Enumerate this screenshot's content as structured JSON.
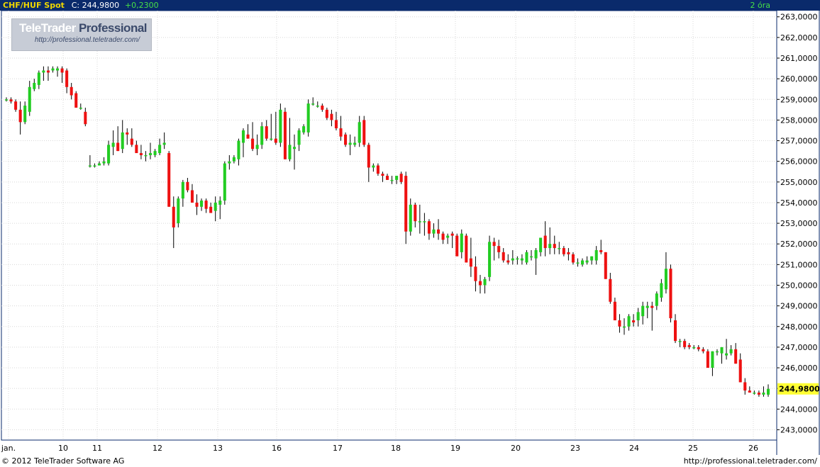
{
  "header": {
    "symbol": "CHF/HUF Spot",
    "close_label": "C: 244,9800",
    "change": "+0,2300",
    "interval": "2 óra"
  },
  "logo": {
    "brand": "TeleTrader",
    "brand_suffix": "Professional",
    "url": "http://professional.teletrader.com/"
  },
  "footer": {
    "copyright": "© 2012  TeleTrader Software AG",
    "url": "http://professional.teletrader.com/"
  },
  "colors": {
    "up": "#22cc22",
    "down": "#ee1111",
    "wick": "#000000",
    "grid": "#d8d8d8",
    "axis_bg": "#ffffff",
    "frame": "#0a2a6b",
    "last_price_bg": "#ffff33"
  },
  "chart_data": {
    "type": "candlestick",
    "ylim": [
      242.5,
      263.3
    ],
    "yticks": [
      "263,0000",
      "262,0000",
      "261,0000",
      "260,0000",
      "259,0000",
      "258,0000",
      "257,0000",
      "256,0000",
      "255,0000",
      "254,0000",
      "253,0000",
      "252,0000",
      "251,0000",
      "250,0000",
      "249,0000",
      "248,0000",
      "247,0000",
      "246,0000",
      "245,0000",
      "244,0000",
      "243,0000"
    ],
    "ytick_values": [
      263,
      262,
      261,
      260,
      259,
      258,
      257,
      256,
      255,
      254,
      253,
      252,
      251,
      250,
      249,
      248,
      247,
      246,
      244,
      243
    ],
    "last_price": 244.98,
    "last_price_label": "244,9800",
    "xticks": [
      "jan.",
      "10",
      "11",
      "12",
      "13",
      "16",
      "17",
      "18",
      "19",
      "20",
      "23",
      "24",
      "25",
      "26"
    ],
    "candles": [
      [
        259.0,
        259.1,
        258.9,
        259.0
      ],
      [
        259.0,
        259.1,
        258.8,
        258.9
      ],
      [
        258.9,
        259.0,
        258.4,
        258.5
      ],
      [
        258.5,
        258.9,
        257.3,
        257.9
      ],
      [
        257.9,
        258.9,
        257.8,
        258.7
      ],
      [
        258.4,
        259.9,
        258.2,
        259.6
      ],
      [
        259.5,
        260.0,
        259.4,
        259.8
      ],
      [
        259.7,
        260.4,
        259.5,
        260.3
      ],
      [
        260.3,
        260.6,
        259.9,
        260.4
      ],
      [
        260.4,
        260.6,
        259.9,
        260.3
      ],
      [
        260.4,
        260.6,
        260.3,
        260.5
      ],
      [
        260.4,
        260.6,
        260.1,
        260.5
      ],
      [
        260.5,
        260.6,
        259.8,
        260.3
      ],
      [
        260.4,
        260.5,
        259.3,
        259.6
      ],
      [
        259.6,
        259.8,
        259.0,
        259.2
      ],
      [
        259.3,
        259.4,
        258.6,
        258.6
      ],
      [
        258.6,
        258.8,
        258.5,
        258.6
      ],
      [
        258.4,
        258.6,
        257.7,
        257.8
      ],
      [
        255.8,
        256.3,
        255.7,
        255.8
      ],
      [
        255.8,
        255.9,
        255.7,
        255.8
      ],
      [
        255.8,
        256.0,
        255.8,
        255.9
      ],
      [
        255.9,
        256.2,
        255.8,
        256.0
      ],
      [
        255.9,
        257.0,
        255.8,
        256.8
      ],
      [
        256.7,
        257.5,
        256.3,
        256.9
      ],
      [
        256.9,
        257.7,
        256.5,
        256.5
      ],
      [
        256.6,
        258.0,
        256.4,
        257.4
      ],
      [
        257.4,
        257.6,
        256.8,
        257.3
      ],
      [
        257.1,
        257.6,
        256.7,
        256.8
      ],
      [
        256.8,
        257.0,
        256.5,
        256.4
      ],
      [
        256.4,
        256.8,
        256.1,
        256.3
      ],
      [
        256.3,
        256.5,
        256.0,
        256.3
      ],
      [
        256.3,
        256.9,
        256.1,
        256.4
      ],
      [
        256.3,
        256.6,
        256.2,
        256.5
      ],
      [
        256.4,
        257.1,
        256.3,
        256.8
      ],
      [
        256.8,
        257.4,
        256.6,
        256.9
      ],
      [
        256.4,
        256.5,
        253.8,
        253.8
      ],
      [
        253.8,
        254.3,
        251.8,
        252.8
      ],
      [
        253.0,
        254.3,
        252.8,
        254.2
      ],
      [
        254.2,
        255.1,
        253.8,
        255.0
      ],
      [
        255.0,
        255.2,
        254.5,
        254.6
      ],
      [
        254.6,
        254.9,
        254.0,
        254.0
      ],
      [
        254.0,
        254.4,
        253.4,
        253.8
      ],
      [
        253.8,
        254.2,
        253.6,
        254.1
      ],
      [
        254.1,
        254.2,
        253.5,
        253.7
      ],
      [
        253.8,
        254.0,
        253.5,
        253.5
      ],
      [
        253.6,
        254.3,
        253.1,
        254.0
      ],
      [
        253.9,
        254.3,
        253.2,
        254.1
      ],
      [
        254.1,
        256.0,
        253.9,
        255.9
      ],
      [
        255.9,
        256.3,
        255.6,
        256.0
      ],
      [
        256.0,
        256.3,
        255.9,
        256.2
      ],
      [
        256.1,
        257.1,
        255.8,
        257.0
      ],
      [
        256.9,
        257.6,
        256.2,
        257.5
      ],
      [
        257.3,
        257.8,
        257.1,
        257.1
      ],
      [
        257.1,
        257.9,
        256.5,
        256.6
      ],
      [
        256.6,
        257.3,
        256.3,
        256.8
      ],
      [
        256.8,
        257.9,
        256.6,
        257.7
      ],
      [
        257.7,
        258.0,
        257.0,
        257.1
      ],
      [
        257.1,
        258.3,
        257.0,
        257.1
      ],
      [
        257.1,
        258.4,
        256.8,
        256.9
      ],
      [
        256.9,
        258.8,
        256.7,
        258.5
      ],
      [
        258.4,
        258.6,
        256.1,
        256.1
      ],
      [
        256.1,
        258.1,
        256.0,
        256.8
      ],
      [
        256.6,
        257.3,
        255.6,
        256.7
      ],
      [
        256.8,
        257.6,
        256.5,
        257.5
      ],
      [
        257.4,
        257.8,
        257.3,
        257.7
      ],
      [
        257.4,
        259.0,
        257.2,
        258.8
      ],
      [
        258.8,
        259.1,
        258.7,
        258.8
      ],
      [
        258.7,
        258.9,
        258.6,
        258.7
      ],
      [
        258.7,
        258.8,
        258.4,
        258.5
      ],
      [
        258.5,
        258.6,
        258.0,
        258.1
      ],
      [
        258.3,
        258.5,
        257.7,
        258.0
      ],
      [
        258.0,
        258.4,
        257.5,
        257.6
      ],
      [
        257.6,
        258.2,
        257.0,
        257.2
      ],
      [
        257.3,
        257.4,
        256.7,
        256.8
      ],
      [
        256.8,
        257.3,
        256.3,
        256.9
      ],
      [
        256.8,
        257.2,
        256.7,
        256.9
      ],
      [
        256.9,
        258.2,
        256.7,
        257.9
      ],
      [
        258.0,
        258.2,
        256.7,
        256.8
      ],
      [
        256.8,
        256.9,
        255.0,
        255.7
      ],
      [
        255.7,
        255.9,
        255.5,
        255.8
      ],
      [
        255.8,
        255.9,
        255.3,
        255.4
      ],
      [
        255.4,
        255.5,
        255.0,
        255.3
      ],
      [
        255.3,
        255.4,
        255.1,
        255.1
      ],
      [
        255.1,
        255.3,
        254.9,
        255.1
      ],
      [
        255.1,
        255.3,
        254.9,
        255.3
      ],
      [
        255.4,
        255.5,
        254.9,
        255.0
      ],
      [
        255.3,
        255.5,
        252.0,
        252.6
      ],
      [
        252.6,
        254.2,
        252.4,
        253.9
      ],
      [
        253.9,
        254.0,
        252.8,
        253.1
      ],
      [
        253.1,
        253.9,
        252.5,
        253.1
      ],
      [
        253.1,
        253.5,
        252.4,
        253.1
      ],
      [
        253.1,
        253.2,
        252.2,
        252.5
      ],
      [
        252.5,
        253.0,
        252.3,
        252.7
      ],
      [
        252.7,
        253.2,
        252.2,
        252.5
      ],
      [
        252.5,
        252.6,
        252.0,
        252.2
      ],
      [
        252.3,
        252.5,
        252.0,
        252.4
      ],
      [
        252.5,
        252.6,
        251.8,
        252.4
      ],
      [
        252.4,
        252.5,
        251.5,
        251.4
      ],
      [
        251.6,
        252.7,
        251.3,
        252.5
      ],
      [
        252.4,
        252.5,
        251.1,
        251.1
      ],
      [
        251.3,
        252.3,
        250.4,
        250.9
      ],
      [
        250.9,
        251.4,
        249.7,
        250.2
      ],
      [
        250.2,
        250.5,
        249.6,
        250.0
      ],
      [
        250.0,
        250.4,
        249.6,
        250.3
      ],
      [
        250.4,
        252.4,
        250.2,
        252.1
      ],
      [
        252.1,
        252.3,
        251.2,
        251.9
      ],
      [
        251.9,
        252.2,
        251.3,
        251.6
      ],
      [
        251.6,
        251.8,
        251.1,
        251.2
      ],
      [
        251.2,
        251.5,
        251.0,
        251.1
      ],
      [
        251.2,
        251.7,
        251.0,
        251.3
      ],
      [
        251.3,
        251.4,
        251.0,
        251.3
      ],
      [
        251.2,
        251.5,
        251.0,
        251.3
      ],
      [
        251.1,
        251.7,
        251.0,
        251.6
      ],
      [
        251.4,
        251.7,
        251.2,
        251.4
      ],
      [
        251.3,
        251.8,
        250.5,
        251.7
      ],
      [
        251.6,
        252.1,
        251.4,
        252.3
      ],
      [
        252.4,
        253.1,
        251.4,
        251.8
      ],
      [
        251.8,
        252.8,
        251.5,
        252.0
      ],
      [
        252.0,
        252.4,
        251.5,
        251.8
      ],
      [
        251.8,
        252.1,
        251.5,
        251.8
      ],
      [
        251.8,
        251.9,
        251.4,
        251.5
      ],
      [
        251.6,
        251.8,
        251.2,
        251.5
      ],
      [
        251.5,
        251.6,
        251.0,
        251.1
      ],
      [
        251.1,
        251.3,
        250.9,
        251.1
      ],
      [
        251.0,
        251.3,
        250.9,
        251.2
      ],
      [
        251.1,
        251.4,
        251.0,
        251.2
      ],
      [
        251.2,
        251.4,
        251.0,
        251.4
      ],
      [
        251.2,
        251.9,
        251.0,
        251.7
      ],
      [
        251.7,
        252.2,
        251.5,
        251.6
      ],
      [
        251.6,
        251.6,
        250.3,
        250.3
      ],
      [
        250.3,
        250.6,
        249.1,
        249.2
      ],
      [
        249.2,
        249.4,
        248.3,
        248.3
      ],
      [
        248.3,
        248.6,
        247.7,
        248.0
      ],
      [
        248.0,
        248.4,
        247.6,
        248.0
      ],
      [
        248.0,
        248.6,
        247.8,
        248.5
      ],
      [
        248.3,
        248.6,
        248.0,
        248.2
      ],
      [
        248.3,
        248.9,
        248.0,
        248.7
      ],
      [
        248.5,
        249.2,
        248.1,
        249.0
      ],
      [
        248.9,
        249.2,
        248.4,
        249.0
      ],
      [
        249.0,
        249.2,
        247.8,
        248.9
      ],
      [
        249.0,
        249.7,
        248.8,
        249.6
      ],
      [
        249.4,
        250.3,
        249.2,
        250.1
      ],
      [
        249.8,
        251.6,
        249.6,
        250.8
      ],
      [
        250.8,
        251.0,
        248.2,
        248.4
      ],
      [
        248.3,
        248.6,
        247.2,
        247.3
      ],
      [
        247.3,
        247.4,
        247.0,
        247.3
      ],
      [
        247.3,
        247.4,
        246.9,
        247.0
      ],
      [
        247.1,
        247.2,
        246.9,
        247.0
      ],
      [
        247.0,
        247.1,
        246.9,
        247.0
      ],
      [
        247.0,
        247.1,
        246.8,
        246.9
      ],
      [
        246.9,
        247.0,
        246.7,
        246.8
      ],
      [
        246.8,
        246.9,
        246.0,
        246.0
      ],
      [
        246.0,
        246.8,
        245.6,
        246.8
      ],
      [
        246.8,
        246.9,
        246.6,
        246.8
      ],
      [
        246.7,
        247.0,
        246.2,
        247.0
      ],
      [
        246.6,
        247.4,
        246.4,
        246.7
      ],
      [
        246.7,
        247.1,
        246.6,
        246.9
      ],
      [
        246.9,
        247.2,
        246.2,
        246.2
      ],
      [
        246.4,
        246.7,
        245.3,
        245.3
      ],
      [
        245.3,
        245.5,
        244.7,
        244.9
      ],
      [
        244.9,
        245.1,
        244.8,
        244.8
      ],
      [
        244.8,
        244.9,
        244.7,
        244.8
      ],
      [
        244.8,
        244.9,
        244.6,
        244.7
      ],
      [
        244.7,
        245.1,
        244.6,
        244.8
      ],
      [
        244.7,
        245.2,
        244.6,
        244.98
      ]
    ]
  }
}
